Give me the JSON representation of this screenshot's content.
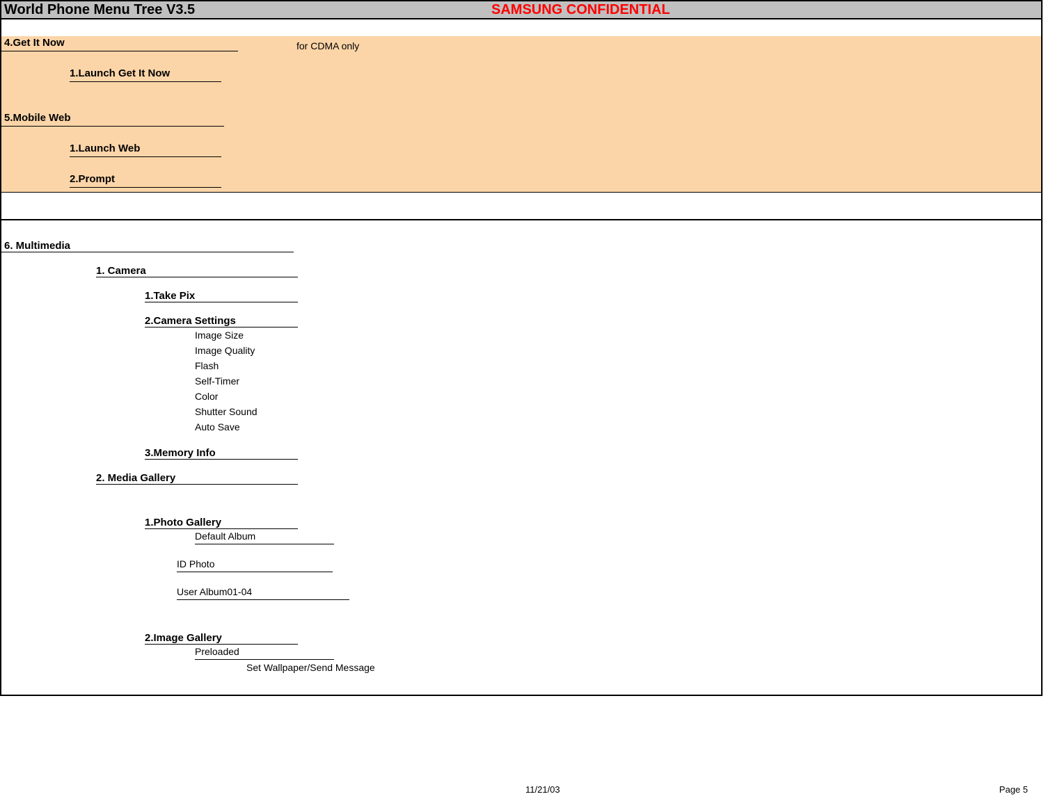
{
  "header": {
    "title": "World Phone Menu Tree V3.5",
    "confidential": "SAMSUNG CONFIDENTIAL"
  },
  "orange": {
    "getitnow": "4.Get It Now",
    "cdma_note": "for CDMA only",
    "launch_getitnow": "1.Launch Get It Now",
    "mobileweb": "5.Mobile Web",
    "launch_web": "1.Launch Web",
    "prompt": "2.Prompt"
  },
  "multimedia": {
    "title": "6. Multimedia",
    "camera": {
      "title": "1. Camera",
      "take_pix": "1.Take Pix",
      "camera_settings": "2.Camera Settings",
      "settings_items": [
        "Image Size",
        "Image Quality",
        "Flash",
        "Self-Timer",
        "Color",
        "Shutter Sound",
        "Auto Save"
      ],
      "memory_info": "3.Memory Info"
    },
    "media_gallery": {
      "title": "2. Media Gallery",
      "photo_gallery": {
        "title": "1.Photo Gallery",
        "items": [
          "Default Album",
          "ID Photo",
          "User Album01-04"
        ]
      },
      "image_gallery": {
        "title": "2.Image Gallery",
        "preloaded": "Preloaded",
        "action": "Set Wallpaper/Send Message"
      }
    }
  },
  "footer": {
    "date": "11/21/03",
    "page": "Page 5"
  }
}
